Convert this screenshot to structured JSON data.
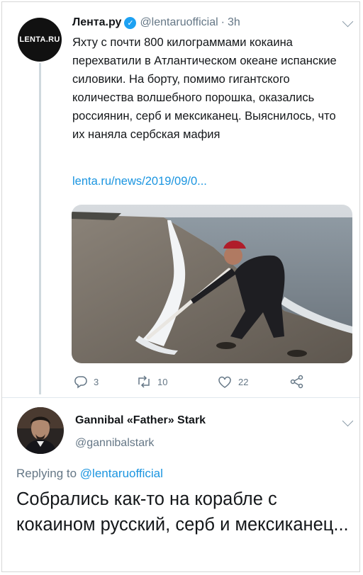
{
  "tweet": {
    "avatar_text": "LENTA.RU",
    "author_name": "Лента.ру",
    "author_handle": "@lentaruofficial",
    "separator": "·",
    "time": "3h",
    "body": "Яхту с почти 800 килограммами кокаина перехватили в Атлантическом океане испанские силовики. На борту, помимо гигантского количества волшебного порошка, оказались россиянин, серб и мексиканец. Выяснилось, что их наняла сербская мафия",
    "link": "lenta.ru/news/2019/09/0...",
    "replies": "3",
    "retweets": "10",
    "likes": "22",
    "icons": {
      "verified": "verified-badge-icon",
      "menu": "chevron-down-icon",
      "reply": "reply-icon",
      "retweet": "retweet-icon",
      "like": "heart-icon",
      "share": "share-icon"
    }
  },
  "reply": {
    "author_name": "Gannibal «Father» Stark",
    "author_handle": "@gannibalstark",
    "replying_prefix": "Replying to",
    "replying_to": "@lentaruofficial",
    "body": "Собрались как-то на корабле с кокаином русский, серб и мексиканец..."
  },
  "colors": {
    "link": "#1b95e0",
    "muted": "#657786",
    "verified": "#1da1f2"
  }
}
